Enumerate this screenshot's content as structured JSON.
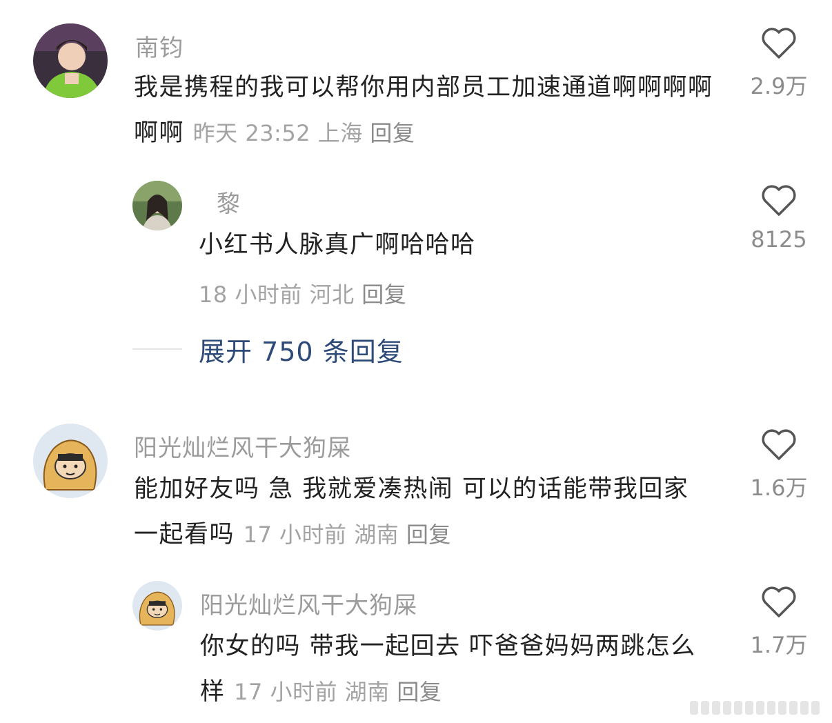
{
  "comments": [
    {
      "username": "南钧",
      "text": "我是携程的我可以帮你用内部员工加速通道啊啊啊啊啊啊",
      "time": "昨天 23:52",
      "location": "上海",
      "reply_label": "回复",
      "likes": "2.9万",
      "avatar_icon": "avatar-green-shirt-man"
    },
    {
      "username": "黎",
      "text": "小红书人脉真广啊哈哈哈",
      "time": "18 小时前",
      "location": "河北",
      "reply_label": "回复",
      "likes": "8125",
      "avatar_icon": "avatar-woman-outdoor"
    },
    {
      "expand_label": "展开 750 条回复"
    },
    {
      "username": "阳光灿烂风干大狗屎",
      "text": "能加好友吗 急 我就爱凑热闹 可以的话能带我回家一起看吗",
      "time": "17 小时前",
      "location": "湖南",
      "reply_label": "回复",
      "likes": "1.6万",
      "avatar_icon": "avatar-cartoon-taiyaki"
    },
    {
      "username": "阳光灿烂风干大狗屎",
      "text": "你女的吗 带我一起回去 吓爸爸妈妈两跳怎么样",
      "time": "17 小时前",
      "location": "湖南",
      "reply_label": "回复",
      "likes": "1.7万",
      "avatar_icon": "avatar-cartoon-taiyaki"
    }
  ],
  "icons": {
    "like": "heart-outline-icon"
  },
  "colors": {
    "username": "#9b9b9b",
    "meta": "#a3a3a3",
    "expand_link": "#2d4a78"
  }
}
